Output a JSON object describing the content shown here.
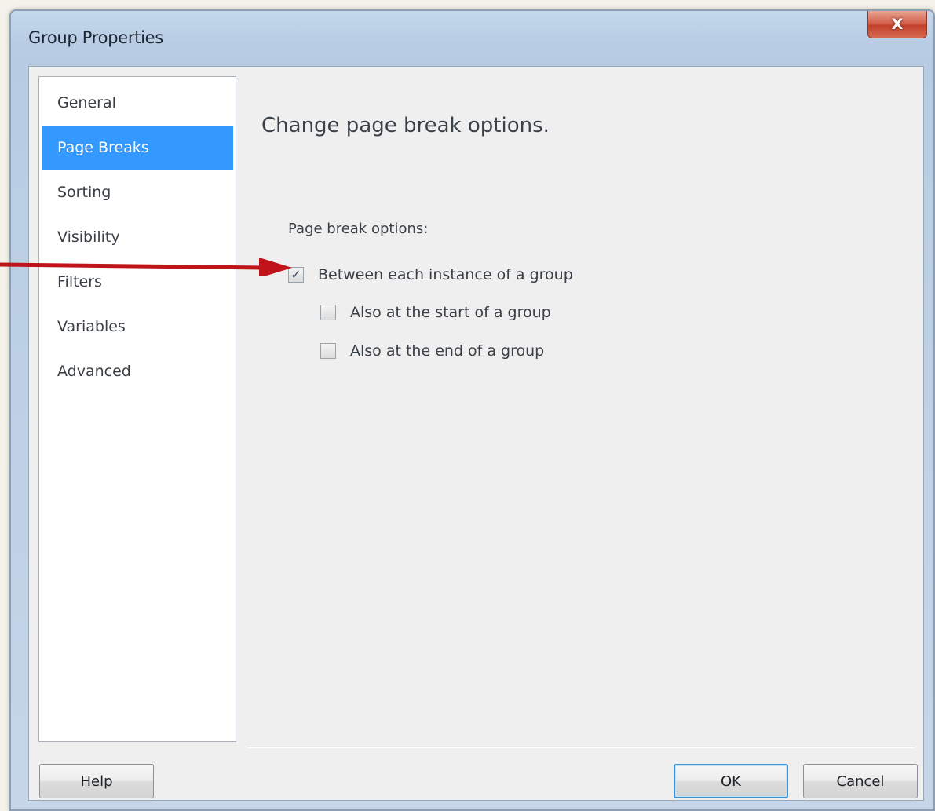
{
  "window": {
    "title": "Group Properties",
    "close_label": "X"
  },
  "nav": {
    "items": [
      {
        "label": "General",
        "selected": false
      },
      {
        "label": "Page Breaks",
        "selected": true
      },
      {
        "label": "Sorting",
        "selected": false
      },
      {
        "label": "Visibility",
        "selected": false
      },
      {
        "label": "Filters",
        "selected": false
      },
      {
        "label": "Variables",
        "selected": false
      },
      {
        "label": "Advanced",
        "selected": false
      }
    ]
  },
  "content": {
    "heading": "Change page break options.",
    "group_label": "Page break options:",
    "options": [
      {
        "label": "Between each instance of a group",
        "checked": true
      },
      {
        "label": "Also at the start of a group",
        "checked": false
      },
      {
        "label": "Also at the end of a group",
        "checked": false
      }
    ]
  },
  "buttons": {
    "help": "Help",
    "ok": "OK",
    "cancel": "Cancel"
  },
  "colors": {
    "selection": "#3399ff",
    "annotation_arrow": "#c0141b"
  },
  "icons": {
    "close": "close-icon",
    "check": "checkmark-icon",
    "annotation": "red-arrow-icon"
  }
}
